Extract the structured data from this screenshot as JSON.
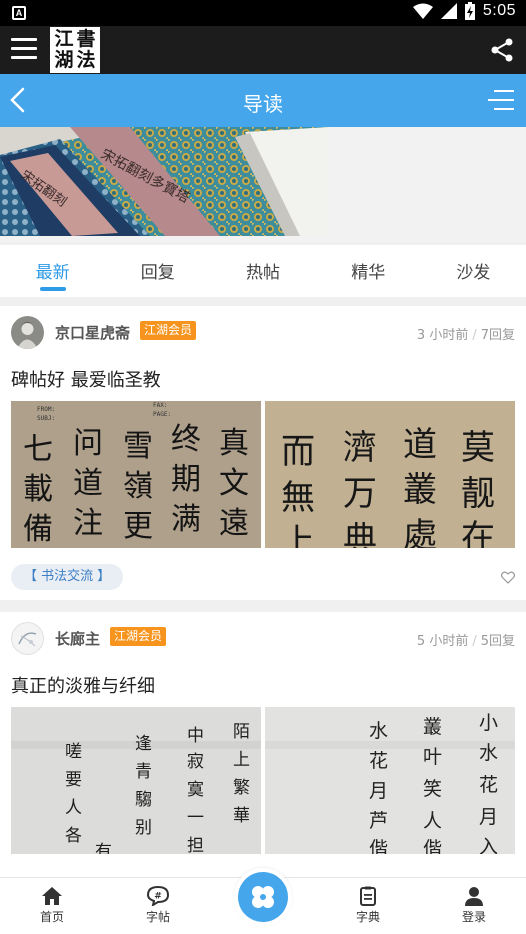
{
  "status_bar": {
    "time": "5:05",
    "indicator": "A"
  },
  "app_bar": {
    "logo_chars": [
      "江",
      "書",
      "湖",
      "法"
    ]
  },
  "title_bar": {
    "title": "导读"
  },
  "tabs": [
    {
      "label": "最新",
      "active": true
    },
    {
      "label": "回复",
      "active": false
    },
    {
      "label": "热帖",
      "active": false
    },
    {
      "label": "精华",
      "active": false
    },
    {
      "label": "沙发",
      "active": false
    }
  ],
  "posts": [
    {
      "author": "京口星虎斋",
      "badge": "江湖会员",
      "time": "3 小时前",
      "replies": "7回复",
      "title": "碑帖好 最爱临圣教",
      "tag": "【 书法交流 】",
      "images": [
        {
          "chars": [
            "真",
            "终",
            "雪",
            "问",
            "七",
            "文",
            "期",
            "嶺",
            "道",
            "載",
            "遠",
            "满",
            "更",
            "注",
            "備"
          ],
          "label_top": [
            "FROM:",
            "SUBJ:",
            "FAX:",
            "PAGE:"
          ]
        },
        {
          "chars": [
            "莫",
            "道",
            "濟",
            "而",
            "靓",
            "叢",
            "万",
            "無",
            "在",
            "處",
            "典",
            "上"
          ]
        }
      ]
    },
    {
      "author": "长廊主",
      "badge": "江湖会员",
      "time": "5 小时前",
      "replies": "5回复",
      "title": "真正的淡雅与纤细",
      "images": [
        {
          "chars": [
            "陌",
            "中",
            "逢",
            "嗟",
            "上",
            "寂",
            "青",
            "要",
            "繁",
            "寞",
            "騶",
            "人",
            "華",
            "一",
            "别",
            "各",
            "担",
            "有"
          ]
        },
        {
          "chars": [
            "小",
            "叢",
            "水",
            "水",
            "叶",
            "花",
            "花",
            "笑",
            "月",
            "月",
            "人",
            "芦",
            "入",
            "偕",
            "偕"
          ]
        }
      ]
    }
  ],
  "bottom_nav": [
    {
      "label": "首页",
      "icon": "home-icon"
    },
    {
      "label": "字帖",
      "icon": "chat-icon"
    },
    {
      "label": "字典",
      "icon": "dictionary-icon"
    },
    {
      "label": "登录",
      "icon": "user-icon"
    }
  ],
  "colors": {
    "primary": "#45a6eb",
    "badge": "#f7941d",
    "app_bar": "#1c1c1c"
  }
}
